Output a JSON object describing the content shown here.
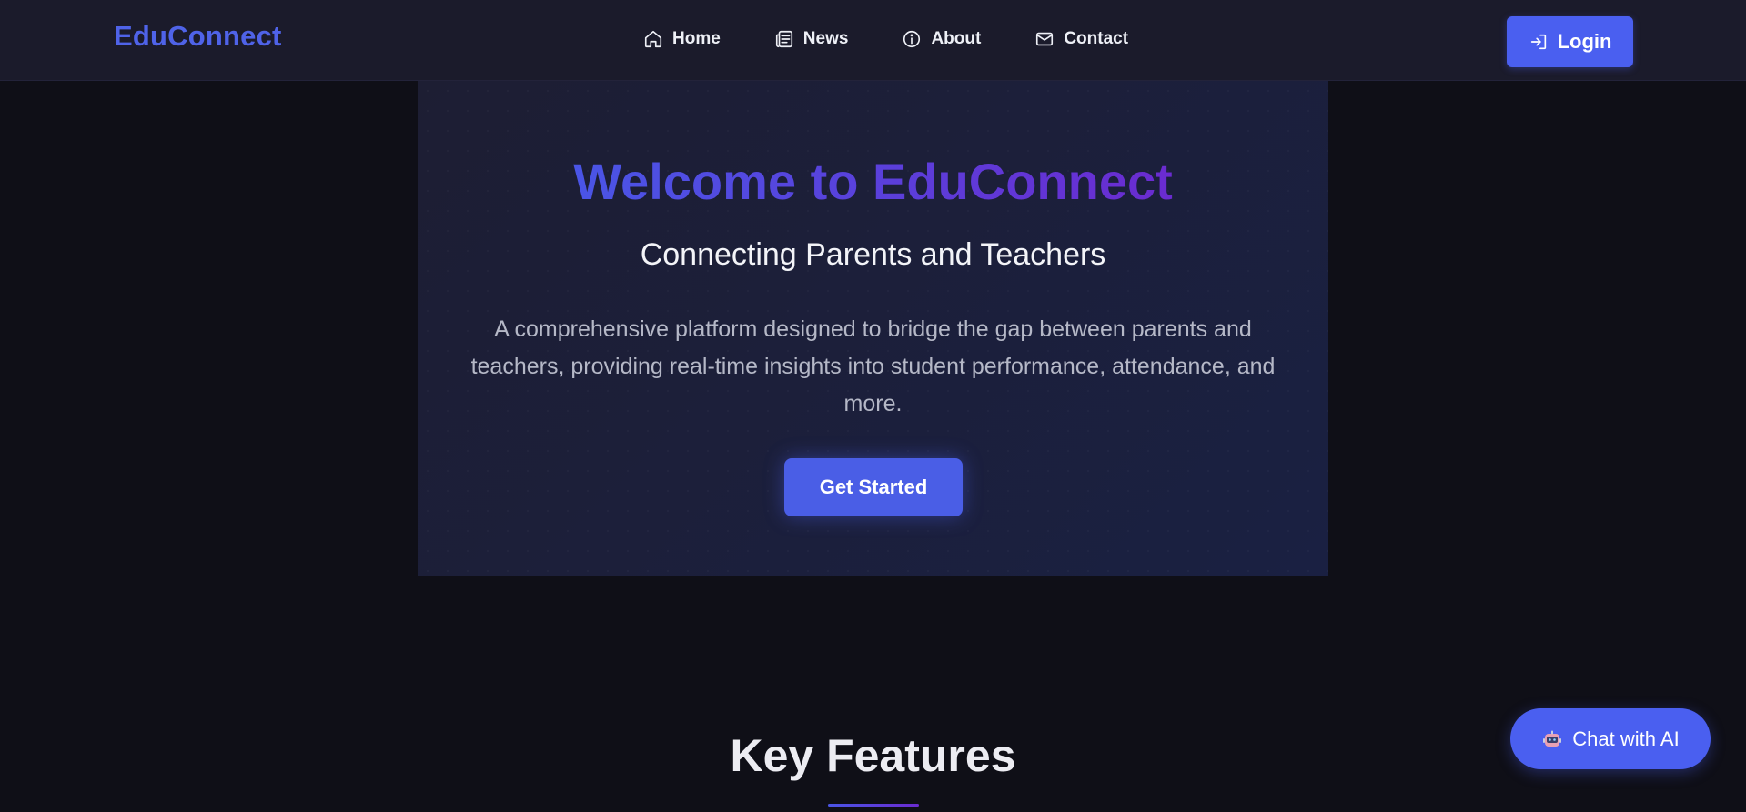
{
  "navbar": {
    "brand": "EduConnect",
    "links": [
      {
        "label": "Home",
        "icon": "home-icon"
      },
      {
        "label": "News",
        "icon": "newspaper-icon"
      },
      {
        "label": "About",
        "icon": "info-icon"
      },
      {
        "label": "Contact",
        "icon": "mail-icon"
      }
    ],
    "login_label": "Login",
    "login_icon": "login-icon"
  },
  "hero": {
    "title": "Welcome to EduConnect",
    "subtitle": "Connecting Parents and Teachers",
    "description": "A comprehensive platform designed to bridge the gap between parents and teachers, providing real-time insights into student performance, attendance, and more.",
    "cta_label": "Get Started"
  },
  "features": {
    "title": "Key Features"
  },
  "chat": {
    "label": "Chat with AI",
    "icon": "robot-icon"
  },
  "colors": {
    "accent": "#4a5ff0",
    "background": "#0f0f17",
    "navbar": "#1b1b2b",
    "gradient_start": "#4a55e6",
    "gradient_end": "#6a2bd0"
  }
}
